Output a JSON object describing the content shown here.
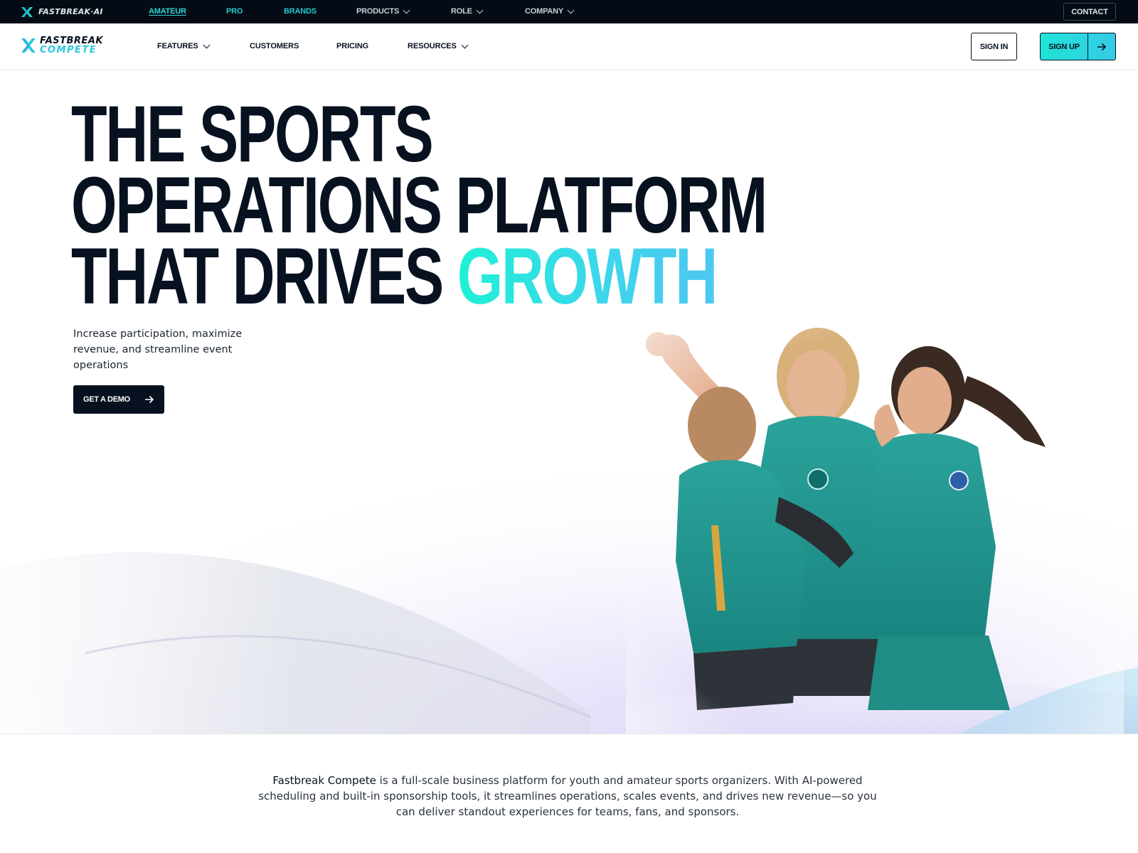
{
  "global_bar": {
    "logo_text": "FASTBREAK·AI",
    "nav": [
      {
        "label": "AMATEUR",
        "active": true
      },
      {
        "label": "PRO"
      },
      {
        "label": "BRANDS"
      },
      {
        "label": "PRODUCTS",
        "has_dropdown": true
      },
      {
        "label": "ROLE",
        "has_dropdown": true
      },
      {
        "label": "COMPANY",
        "has_dropdown": true
      }
    ],
    "contact_label": "CONTACT"
  },
  "header": {
    "brand_top": "FASTBREAK",
    "brand_bottom": "COMPETE",
    "nav": [
      {
        "label": "FEATURES",
        "has_dropdown": true
      },
      {
        "label": "CUSTOMERS"
      },
      {
        "label": "PRICING"
      },
      {
        "label": "RESOURCES",
        "has_dropdown": true
      }
    ],
    "sign_in_label": "SIGN IN",
    "sign_up_label": "SIGN UP"
  },
  "hero": {
    "headline_line1": "THE SPORTS",
    "headline_line2": "OPERATIONS PLATFORM",
    "headline_line3_prefix": "THAT DRIVES ",
    "headline_accent": "GROWTH",
    "subcopy": "Increase participation, maximize revenue, and streamline event operations",
    "cta_label": "GET A DEMO",
    "image_subject": "soccer-players-celebrating"
  },
  "intro": {
    "lead": "Fastbreak Compete",
    "body": " is a full-scale business platform for youth and amateur sports organizers. With AI-powered scheduling and built-in sponsorship tools, it streamlines operations, scales events, and drives new revenue—so you can deliver standout experiences for teams, fans, and sponsors."
  },
  "colors": {
    "navy": "#07111f",
    "teal": "#2bd6d6",
    "accent_gradient_start": "#1ff0d6",
    "accent_gradient_end": "#4ec7f0",
    "jersey": "#1f9a93"
  },
  "icons": {
    "logo": "fastbreak-x-icon",
    "dropdown": "chevron-down-icon",
    "arrow": "arrow-right-icon",
    "collapse": "chevron-up-icon"
  }
}
